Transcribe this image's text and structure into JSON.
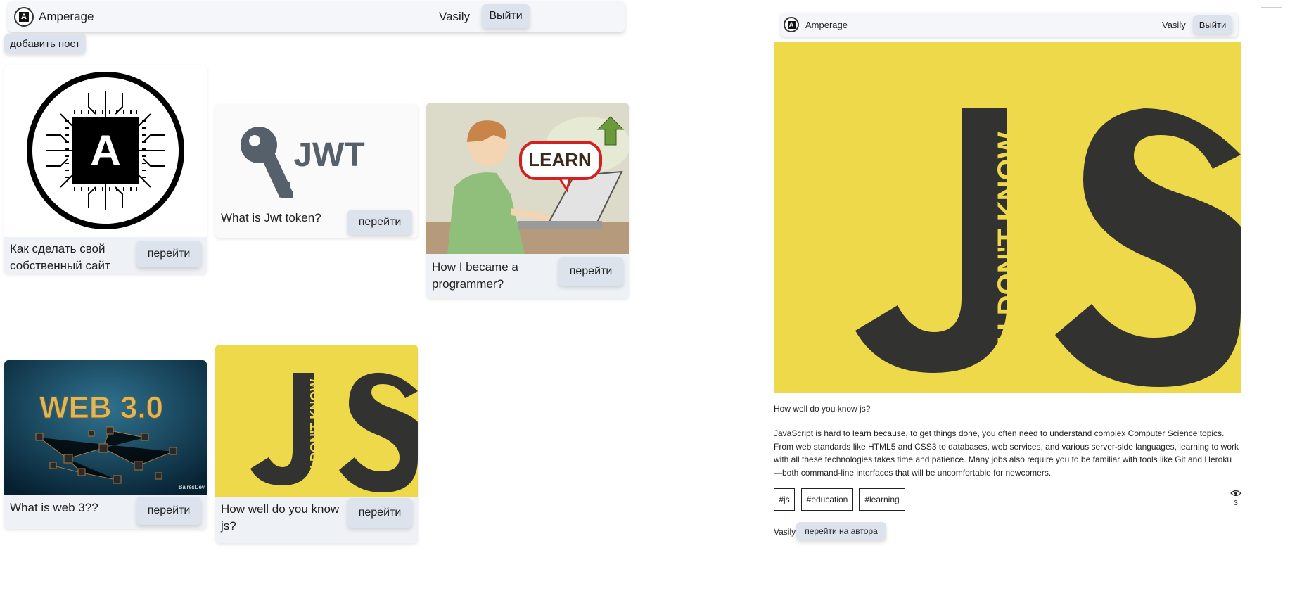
{
  "left": {
    "navbar": {
      "brand": "Amperage",
      "user": "Vasily",
      "logout_label": "Выйти"
    },
    "add_post_label": "добавить пост",
    "go_label": "перейти",
    "cards": [
      {
        "title": "Как сделать свой собственный сайт",
        "image": "amperage-chip-logo"
      },
      {
        "title": "What is Jwt token?",
        "image": "jwt-key-logo"
      },
      {
        "title": "How I became a programmer?",
        "image": "learn-laptop-illustration"
      },
      {
        "title": "What is web 3??",
        "image": "web3-network"
      },
      {
        "title": "How well do you know js?",
        "image": "ydkjs-cover"
      }
    ],
    "image_text": {
      "chip_letter": "A",
      "jwt": "JWT",
      "learn": "LEARN",
      "web3": "WEB 3.0",
      "web3_brand": "BairesDev",
      "js": "JS",
      "ydk": "YOU DON'T KNOW"
    }
  },
  "right": {
    "navbar": {
      "brand": "Amperage",
      "user": "Vasily",
      "logout_label": "Выйти"
    },
    "post": {
      "title": "How well do you know js?",
      "body": "JavaScript is hard to learn because, to get things done, you often need to understand complex Computer Science topics. From web standards like HTML5 and CSS3 to databases, web services, and various server-side languages, learning to work with all these technologies takes time and patience. Many jobs also require you to be familiar with tools like Git and Heroku—both command-line interfaces that will be uncomfortable for newcomers.",
      "tags": [
        "#js",
        "#education",
        "#learning"
      ],
      "views": "3",
      "author": "Vasily",
      "author_button": "перейти на автора"
    }
  },
  "colors": {
    "js_yellow": "#eed94a",
    "js_dark": "#323330",
    "button_bg": "#dde3ec",
    "card_bg": "#eef1f6"
  }
}
